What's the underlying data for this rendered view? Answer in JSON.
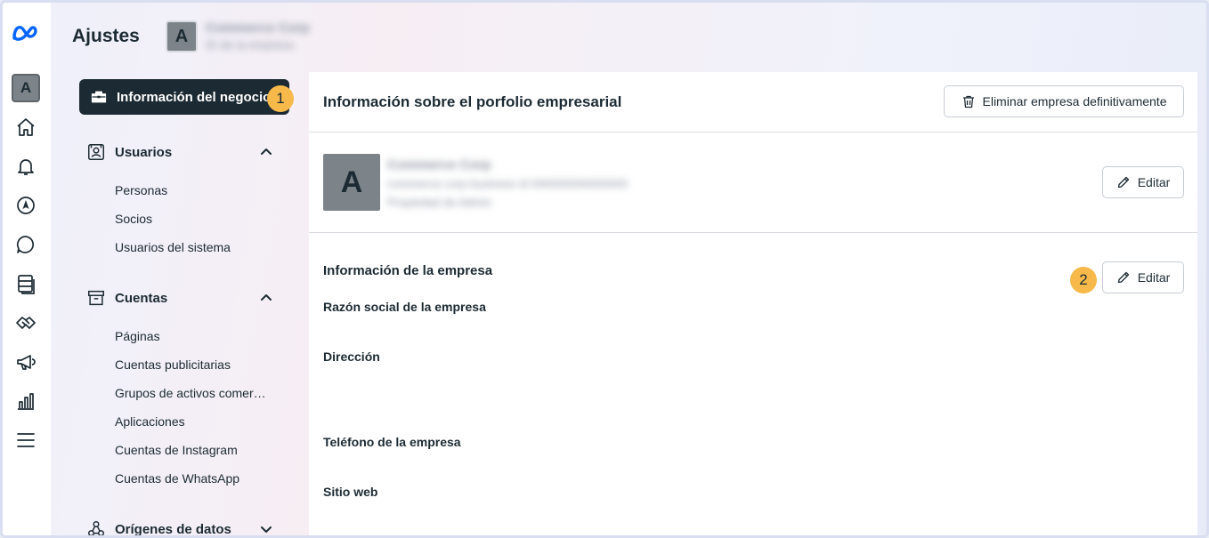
{
  "header": {
    "title": "Ajustes",
    "avatar_letter": "A",
    "account_name": "Commerce Corp",
    "account_sub": "ID de la empresa"
  },
  "rail": {
    "avatar_letter": "A",
    "icons": [
      "meta-logo-icon",
      "home-icon",
      "bell-icon",
      "compass-icon",
      "chat-icon",
      "catalog-icon",
      "handshake-icon",
      "megaphone-icon",
      "bar-chart-icon",
      "menu-icon"
    ]
  },
  "sidebar": {
    "active_label": "Información del negocio",
    "badge1": "1",
    "sections": [
      {
        "label": "Usuarios",
        "items": [
          "Personas",
          "Socios",
          "Usuarios del sistema"
        ]
      },
      {
        "label": "Cuentas",
        "items": [
          "Páginas",
          "Cuentas publicitarias",
          "Grupos de activos comer…",
          "Aplicaciones",
          "Cuentas de Instagram",
          "Cuentas de WhatsApp"
        ]
      },
      {
        "label": "Orígenes de datos",
        "items": []
      }
    ]
  },
  "main": {
    "title": "Información sobre el porfolio empresarial",
    "delete_label": "Eliminar empresa definitivamente",
    "biz_avatar_letter": "A",
    "biz_name": "Commerce Corp",
    "biz_line1": "commerce corp business id 000000000000000",
    "biz_line2": "Propiedad de Admin",
    "edit_label": "Editar",
    "edit_label_2": "Editar",
    "badge2": "2",
    "section_title": "Información de la empresa",
    "fields": [
      "Razón social de la empresa",
      "Dirección",
      "Teléfono de la empresa",
      "Sitio web"
    ]
  }
}
